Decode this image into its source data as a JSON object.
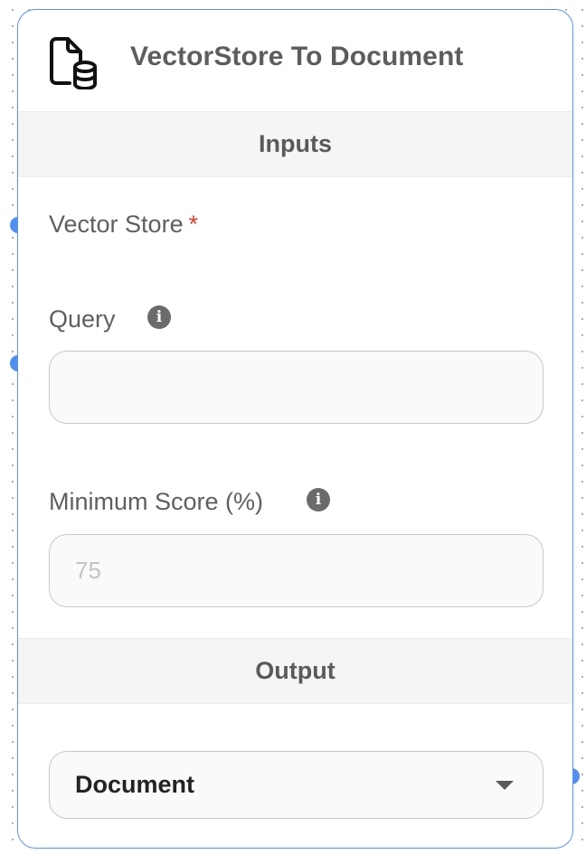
{
  "node": {
    "title": "VectorStore To Document",
    "icon": "file-database-icon"
  },
  "inputs_section": {
    "label": "Inputs"
  },
  "vector_store": {
    "label": "Vector Store",
    "required_mark": "*"
  },
  "query": {
    "label": "Query",
    "value": "",
    "placeholder": ""
  },
  "minimum_score": {
    "label": "Minimum Score (%)",
    "value": "",
    "placeholder": "75"
  },
  "output_section": {
    "label": "Output"
  },
  "output_select": {
    "value": "Document"
  },
  "colors": {
    "accent": "#4f8ff0",
    "required": "#d64030",
    "border": "#5a93e8"
  }
}
